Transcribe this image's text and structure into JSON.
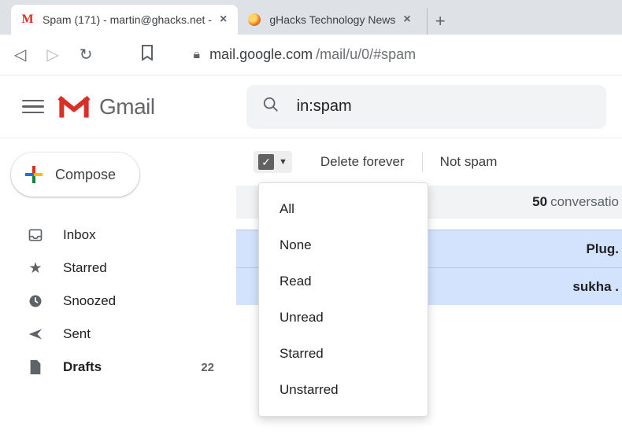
{
  "browser": {
    "tabs": [
      {
        "title": "Spam (171) - martin@ghacks.net -",
        "favicon": "gmail"
      },
      {
        "title": "gHacks Technology News",
        "favicon": "ghacks"
      }
    ],
    "url_host": "mail.google.com",
    "url_path": "/mail/u/0/#spam"
  },
  "header": {
    "product": "Gmail",
    "search_value": "in:spam"
  },
  "sidebar": {
    "compose_label": "Compose",
    "items": [
      {
        "icon": "inbox",
        "label": "Inbox",
        "count": ""
      },
      {
        "icon": "star",
        "label": "Starred",
        "count": ""
      },
      {
        "icon": "clock",
        "label": "Snoozed",
        "count": ""
      },
      {
        "icon": "send",
        "label": "Sent",
        "count": ""
      },
      {
        "icon": "file",
        "label": "Drafts",
        "count": "22",
        "bold": true
      }
    ]
  },
  "actions": {
    "delete_forever": "Delete forever",
    "not_spam": "Not spam"
  },
  "info_row": {
    "count": "50",
    "suffix": "conversatio"
  },
  "select_menu": [
    "All",
    "None",
    "Read",
    "Unread",
    "Starred",
    "Unstarred"
  ],
  "rows": [
    "Plug.",
    "sukha ."
  ]
}
